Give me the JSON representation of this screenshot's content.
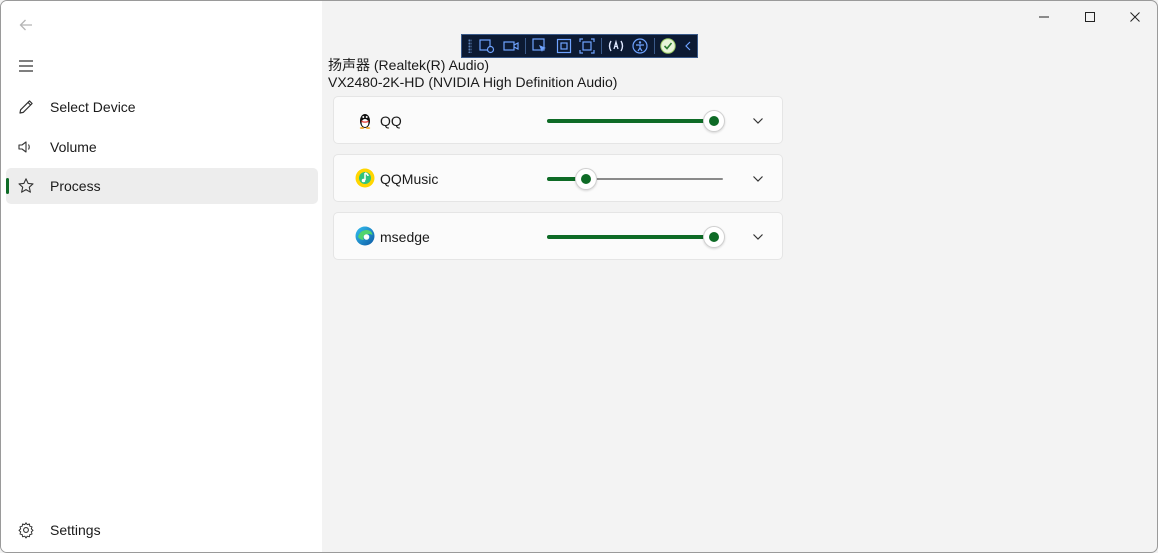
{
  "nav": {
    "items": [
      {
        "label": "Select Device",
        "icon": "pencil-icon",
        "selected": false
      },
      {
        "label": "Volume",
        "icon": "speaker-icon",
        "selected": false
      },
      {
        "label": "Process",
        "icon": "star-icon",
        "selected": true
      }
    ],
    "settings_label": "Settings"
  },
  "devices": {
    "line1": "扬声器 (Realtek(R) Audio)",
    "line2": "VX2480-2K-HD (NVIDIA High Definition Audio)"
  },
  "processes": [
    {
      "name": "QQ",
      "icon": "qq-penguin-icon",
      "volume_fraction": 0.95
    },
    {
      "name": "QQMusic",
      "icon": "qqmusic-icon",
      "volume_fraction": 0.22
    },
    {
      "name": "msedge",
      "icon": "edge-icon",
      "volume_fraction": 0.95
    }
  ],
  "colors": {
    "accent": "#0e6b26",
    "sidebar_bg": "#ffffff",
    "content_bg": "#f3f3f3",
    "toolbar_bg": "#0c1a33"
  }
}
